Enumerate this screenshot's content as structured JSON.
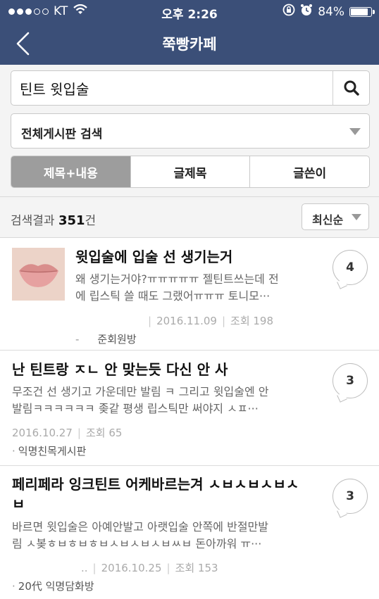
{
  "status_bar": {
    "carrier": "KT",
    "time": "오후 2:26",
    "battery": "84%",
    "battery_level": 0.84
  },
  "nav": {
    "title": "쭉빵카페"
  },
  "search": {
    "query": "틴트 윗입술",
    "board_filter": "전체게시판 검색"
  },
  "search_tabs": [
    {
      "label": "제목+내용",
      "active": true
    },
    {
      "label": "글제목",
      "active": false
    },
    {
      "label": "글쓴이",
      "active": false
    }
  ],
  "results": {
    "label": "검색결과",
    "count": "351",
    "unit": "건",
    "sort": "최신순"
  },
  "posts": [
    {
      "title": "윗입술에 입술 선 생기는거",
      "snippet1": "왜 생기는거야?ㅠㅠㅠㅠㅠ 젤틴트쓰는데 전",
      "snippet2": "에 립스틱 쓸 때도 그랬어ㅠㅠㅠ 토니모···",
      "date": "2016.11.09",
      "views": "조회 198",
      "board": "준회원방",
      "comments": "4"
    },
    {
      "title": "난 틴트랑 ㅈㄴ 안 맞는듯 다신 안 사",
      "snippet1": "무조건 선 생기고 가운데만 발림 ㅋ 그리고 윗입술엔 안",
      "snippet2": "발림ㅋㅋㅋㅋㅋㅋ 좆같 평생 립스틱만 써야지 ㅅㅍ···",
      "date": "2016.10.27",
      "views": "조회 65",
      "board": "익명친목게시판",
      "comments": "3"
    },
    {
      "title1": "페리페라 잉크틴트 어케바르는겨 ㅅㅂㅅㅂㅅㅂㅅ",
      "title2": "ㅂ",
      "snippet1": "바르면 윗입술은 아예안발고 아랫입술 안쪽에 반절만발",
      "snippet2": "림 ㅅ봊ㅎㅂㅎㅂㅎㅂㅅㅂㅅㅂㅅㅂㅆㅂ 돈아까워 ㅠ···",
      "author_fragment": "..",
      "date": "2016.10.25",
      "views": "조회 153",
      "board": "20代 익명담화방",
      "comments": "3"
    }
  ],
  "colors": {
    "header": "#3b4f78",
    "active_tab": "#9d9d9d"
  }
}
